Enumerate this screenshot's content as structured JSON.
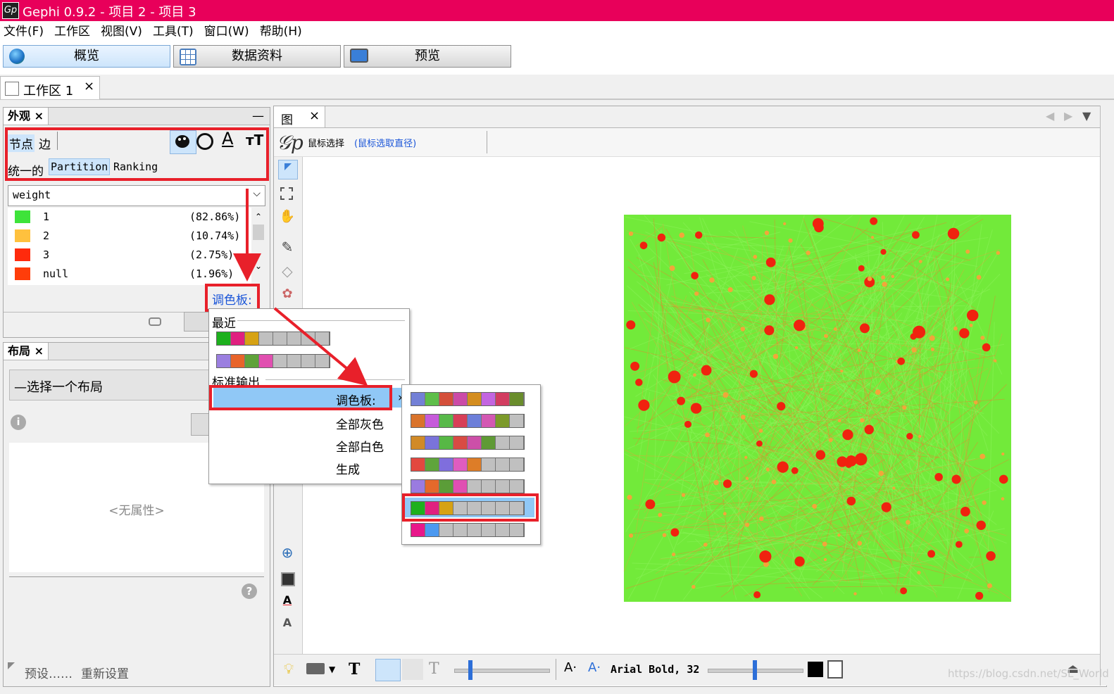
{
  "window": {
    "title": "Gephi 0.9.2 - 项目 2 - 项目 3",
    "app_icon": "Gp"
  },
  "menubar": [
    "文件(F)",
    "工作区",
    "视图(V)",
    "工具(T)",
    "窗口(W)",
    "帮助(H)"
  ],
  "main_tabs": [
    {
      "label": "概览",
      "icon": "globe-icon",
      "active": true
    },
    {
      "label": "数据资料",
      "icon": "table-icon",
      "active": false
    },
    {
      "label": "预览",
      "icon": "monitor-icon",
      "active": false
    }
  ],
  "workspace_tab": {
    "label": "工作区 1",
    "close": "×"
  },
  "appearance": {
    "tab_label": "外观",
    "close": "×",
    "minimize": "—",
    "target_tabs": [
      "节点",
      "边"
    ],
    "mode_tabs": [
      "统一的",
      "Partition",
      "Ranking"
    ],
    "attribute": "weight",
    "partitions": [
      {
        "label": "1",
        "pct": "(82.86%)",
        "color": "#3ee33a"
      },
      {
        "label": "2",
        "pct": "(10.74%)",
        "color": "#ffc13e"
      },
      {
        "label": "3",
        "pct": "(2.75%)",
        "color": "#ff2a0c"
      },
      {
        "label": "null",
        "pct": "(1.96%)",
        "color": "#ff3d0a"
      }
    ],
    "palette_link": "调色板:"
  },
  "layout_panel": {
    "tab_label": "布局",
    "close": "×",
    "select_placeholder": "—选择一个布局",
    "no_properties": "<无属性>",
    "presets": "预设……",
    "reset": "重新设置"
  },
  "palette_menu": {
    "recent_header": "最近",
    "recent": [
      [
        "#1db01d",
        "#e02080",
        "#d6a214",
        "#c0c0c0",
        "#c0c0c0",
        "#c0c0c0",
        "#c0c0c0",
        "#c0c0c0"
      ],
      [
        "#9b7fe0",
        "#e8642a",
        "#5fa23a",
        "#e14fb0",
        "#c0c0c0",
        "#c0c0c0",
        "#c0c0c0",
        "#c0c0c0"
      ]
    ],
    "standard_header": "标准输出",
    "items": [
      "调色板:",
      "全部灰色",
      "全部白色",
      "生成"
    ]
  },
  "palette_submenu": [
    [
      "#7380d6",
      "#5ebe4a",
      "#d44f3a",
      "#cb4ba7",
      "#d48d1f",
      "#c365e0",
      "#d23d60",
      "#6a8d2c"
    ],
    [
      "#d9732b",
      "#c65bda",
      "#58b94a",
      "#d73f58",
      "#6d7fd9",
      "#d358b3",
      "#7c9a2b",
      "#c0c0c0"
    ],
    [
      "#d18a27",
      "#7a73da",
      "#57b845",
      "#d84b44",
      "#cc4fa8",
      "#5f9a35",
      "#c0c0c0",
      "#c0c0c0"
    ],
    [
      "#e3483f",
      "#5fa53b",
      "#7f6edd",
      "#e05cc0",
      "#dd7d28",
      "#c0c0c0",
      "#c0c0c0",
      "#c0c0c0"
    ],
    [
      "#9a7be0",
      "#e4692b",
      "#5b9d38",
      "#e04fb2",
      "#c0c0c0",
      "#c0c0c0",
      "#c0c0c0",
      "#c0c0c0"
    ],
    [
      "#1db01d",
      "#e02080",
      "#d6a214",
      "#c0c0c0",
      "#c0c0c0",
      "#c0c0c0",
      "#c0c0c0",
      "#c0c0c0"
    ],
    [
      "#e8178a",
      "#4c99f0",
      "#c0c0c0",
      "#c0c0c0",
      "#c0c0c0",
      "#c0c0c0",
      "#c0c0c0",
      "#c0c0c0"
    ]
  ],
  "graph": {
    "tab_label": "图",
    "close": "×",
    "mouse_selection": "鼠标选择",
    "mouse_selection_hint": "(鼠标选取直径)",
    "font_label": "Arial Bold, 32"
  },
  "watermark": "https://blog.csdn.net/SL_World"
}
